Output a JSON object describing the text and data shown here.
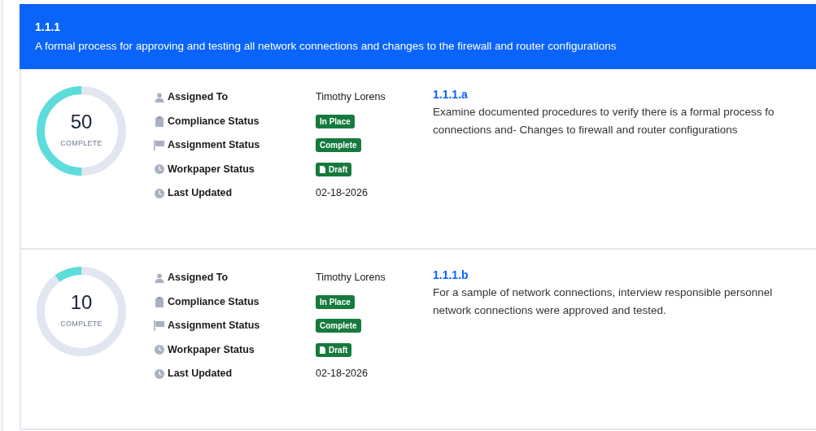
{
  "header": {
    "code": "1.1.1",
    "title": "A formal process for approving and testing all network connections and changes to the firewall and router configurations"
  },
  "items": [
    {
      "level": 0.5,
      "percent": "50",
      "percent_label": "COMPLETE",
      "fields": [
        {
          "kind": "text",
          "label": "Assigned To",
          "value": "Timothy Lorens"
        },
        {
          "kind": "badge",
          "label": "Compliance Status",
          "value": "In Place"
        },
        {
          "kind": "badge",
          "label": "Assignment Status",
          "value": "Complete"
        },
        {
          "kind": "file-badge",
          "label": "Workpaper Status",
          "value": "Draft"
        },
        {
          "kind": "text",
          "label": "Last Updated",
          "value": "02-18-2026"
        }
      ],
      "code": "1.1.1.a",
      "description": [
        "Examine documented procedures to verify there is a formal process fo",
        "connections and- Changes to firewall and router configurations"
      ]
    },
    {
      "level": 0.1,
      "percent": "10",
      "percent_label": "COMPLETE",
      "fields": [
        {
          "kind": "text",
          "label": "Assigned To",
          "value": "Timothy Lorens"
        },
        {
          "kind": "badge",
          "label": "Compliance Status",
          "value": "In Place"
        },
        {
          "kind": "badge",
          "label": "Assignment Status",
          "value": "Complete"
        },
        {
          "kind": "file-badge",
          "label": "Workpaper Status",
          "value": "Draft"
        },
        {
          "kind": "text",
          "label": "Last Updated",
          "value": "02-18-2026"
        }
      ],
      "code": "1.1.1.b",
      "description": [
        "For a sample of network connections, interview responsible personnel",
        "network connections were approved and tested."
      ]
    }
  ]
}
